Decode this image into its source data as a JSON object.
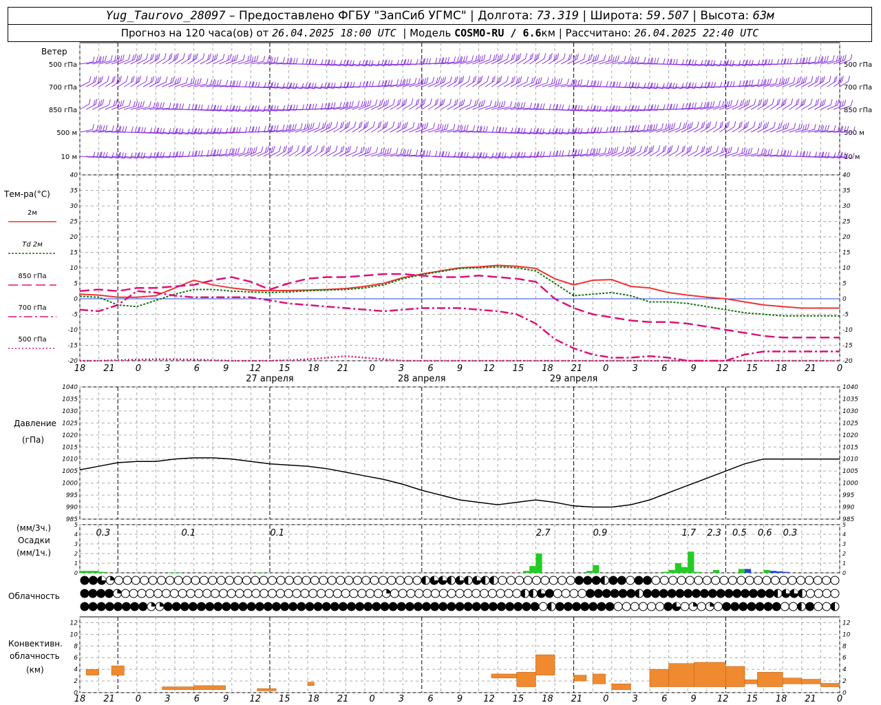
{
  "header": {
    "station": "Yug_Taurovo_28097",
    "provided_by": "– Предоставлено ФГБУ \"ЗапСиб УГМС\"",
    "lon_label": "Долгота:",
    "lon_value": "73.319",
    "lat_label": "Широта:",
    "lat_value": "59.507",
    "alt_label": "Высота:",
    "alt_value": "63м",
    "forecast_label": "Прогноз на 120 часа(ов) от",
    "forecast_start": "26.04.2025 18:00 UTC",
    "model_label": "Модель",
    "model_name": "COSMO-RU / 6.6",
    "model_unit": "км",
    "calc_label": "Рассчитано:",
    "calc_time": "26.04.2025 22:40 UTC"
  },
  "labels": {
    "wind": "Ветер",
    "wind_levels": [
      "500 гПа",
      "700 гПа",
      "850 гПа",
      "500 м",
      "10  м"
    ],
    "temp_title": "Тем-ра(°C)",
    "legend": [
      {
        "label": "2м",
        "color": "#ee3333",
        "style": "solid"
      },
      {
        "label": "Td  2м",
        "color": "#117711",
        "style": "dotted"
      },
      {
        "label": "850 гПа",
        "color": "#dd1177",
        "style": "dash"
      },
      {
        "label": "700 гПа",
        "color": "#dd1177",
        "style": "dashdot"
      },
      {
        "label": "500 гПа",
        "color": "#dd1177",
        "style": "dot"
      }
    ],
    "pressure_title": "Давление",
    "pressure_unit": "(гПа)",
    "precip_unit_3h": "(мм/3ч.)",
    "precip_title": "Осадки",
    "precip_unit_1h": "(мм/1ч.)",
    "cloud_title": "Облачность",
    "conv_title": "Конвективн.",
    "conv_title2": "облачность",
    "conv_unit": "(км)",
    "dates": [
      "27 апреля",
      "28 апреля",
      "29 апреля"
    ]
  },
  "chart_data": [
    {
      "type": "line",
      "name": "temperature",
      "ylim": [
        -20,
        40
      ],
      "yticks": [
        -20,
        -15,
        -10,
        -5,
        0,
        5,
        10,
        15,
        20,
        25,
        30,
        35,
        40
      ],
      "x_hours": [
        0,
        3,
        6,
        9,
        12,
        15,
        18,
        21,
        24,
        27,
        30,
        33,
        36,
        39,
        42,
        45,
        48,
        51,
        54,
        57,
        60,
        63,
        66,
        69,
        72,
        75,
        78,
        81,
        84,
        87,
        90,
        93,
        96,
        99,
        102,
        105,
        108,
        111,
        114,
        117,
        120
      ],
      "series": [
        {
          "name": "2м",
          "values": [
            1.5,
            1.2,
            0.5,
            0.5,
            1.0,
            3.5,
            6.0,
            4.5,
            3.5,
            2.8,
            2.6,
            2.7,
            2.8,
            3.0,
            3.3,
            4.0,
            5.0,
            6.8,
            8.0,
            9.0,
            10.0,
            10.3,
            10.8,
            10.5,
            9.8,
            6.5,
            4.5,
            6.0,
            6.2,
            4.0,
            3.5,
            2.0,
            1.2,
            0.5,
            0.0,
            -1.0,
            -2.0,
            -2.5,
            -3.0,
            -3.0,
            -3.0
          ]
        },
        {
          "name": "Td 2м",
          "values": [
            0.8,
            0.5,
            -2.0,
            -2.5,
            -0.5,
            1.5,
            3.0,
            3.0,
            2.5,
            2.2,
            2.0,
            2.2,
            2.6,
            2.8,
            3.0,
            3.5,
            4.5,
            6.5,
            7.8,
            8.8,
            9.8,
            10.0,
            10.3,
            10.0,
            9.0,
            5.0,
            1.0,
            1.5,
            2.0,
            1.0,
            -1.0,
            -1.0,
            -1.5,
            -2.5,
            -3.5,
            -4.5,
            -5.0,
            -5.5,
            -5.5,
            -5.5,
            -5.5
          ]
        },
        {
          "name": "850 гПа",
          "values": [
            2.5,
            3.0,
            2.5,
            3.5,
            3.5,
            4.0,
            4.5,
            6.0,
            7.0,
            5.5,
            3.0,
            5.0,
            6.5,
            7.0,
            7.0,
            7.5,
            8.0,
            8.0,
            7.5,
            7.0,
            7.0,
            7.5,
            7.0,
            6.5,
            5.5,
            0.0,
            -3.0,
            -5.0,
            -6.0,
            -7.0,
            -7.5,
            -7.5,
            -8.0,
            -9.0,
            -10.0,
            -11.0,
            -12.0,
            -12.5,
            -12.5,
            -12.5,
            -12.5
          ]
        },
        {
          "name": "700 гПа",
          "values": [
            -3.5,
            -4.0,
            -2.0,
            2.5,
            2.0,
            1.0,
            0.5,
            0.5,
            0.5,
            0.5,
            -0.5,
            -1.5,
            -2.0,
            -2.5,
            -3.0,
            -3.5,
            -4.0,
            -3.5,
            -3.0,
            -3.0,
            -3.0,
            -3.5,
            -4.0,
            -5.0,
            -8.0,
            -13.0,
            -16.0,
            -18.0,
            -19.0,
            -19.0,
            -18.5,
            -19.0,
            -20.0,
            -20.0,
            -20.0,
            -18.0,
            -17.0,
            -17.0,
            -17.0,
            -17.0,
            -17.0
          ]
        },
        {
          "name": "500 гПа",
          "values": [
            -20,
            -20,
            -19.8,
            -19.6,
            -19.5,
            -19.5,
            -19.6,
            -19.8,
            -20,
            -20,
            -20,
            -19.8,
            -19.5,
            -19.0,
            -18.5,
            -19.0,
            -19.5,
            -20,
            -20,
            -20,
            -20,
            -20,
            -20,
            -20,
            -20,
            -20,
            -20,
            -20,
            -20,
            -20,
            -20,
            -20,
            -20,
            -20,
            -20,
            -20,
            -20,
            -20,
            -20,
            -20,
            -20
          ]
        }
      ]
    },
    {
      "type": "line",
      "name": "pressure",
      "ylim": [
        985,
        1040
      ],
      "yticks": [
        985,
        990,
        995,
        1000,
        1005,
        1010,
        1015,
        1020,
        1025,
        1030,
        1035,
        1040
      ],
      "x_hours": [
        0,
        3,
        6,
        9,
        12,
        15,
        18,
        21,
        24,
        27,
        30,
        33,
        36,
        39,
        42,
        45,
        48,
        51,
        54,
        57,
        60,
        63,
        66,
        69,
        72,
        75,
        78,
        81,
        84,
        87,
        90,
        93,
        96,
        99,
        102,
        105,
        108,
        111,
        114,
        117,
        120
      ],
      "values": [
        1005.5,
        1007,
        1008.5,
        1009,
        1009,
        1010,
        1010.5,
        1010.5,
        1010,
        1009,
        1008,
        1007.5,
        1007,
        1006,
        1004.5,
        1003,
        1001.5,
        999.5,
        997,
        995,
        993,
        992,
        991,
        992,
        993,
        992,
        990.5,
        990,
        990,
        991,
        993,
        996,
        999,
        1002,
        1005,
        1008,
        1010,
        1010,
        1010,
        1010,
        1010
      ]
    },
    {
      "type": "bar",
      "name": "precipitation",
      "ylim": [
        0,
        5
      ],
      "period_totals": [
        {
          "hour": 1.5,
          "label": "0.3"
        },
        {
          "hour": 15,
          "label": "0.1"
        },
        {
          "hour": 29,
          "label": "0.1"
        },
        {
          "hour": 71,
          "label": "2.7"
        },
        {
          "hour": 80,
          "label": "0.9"
        },
        {
          "hour": 94,
          "label": "1.7"
        },
        {
          "hour": 98,
          "label": "2.3"
        },
        {
          "hour": 102,
          "label": "0.5"
        },
        {
          "hour": 106,
          "label": "0.6"
        },
        {
          "hour": 110,
          "label": "0.3"
        }
      ],
      "bars": [
        {
          "hour": 0,
          "value": 0.2,
          "color": "#22cc22"
        },
        {
          "hour": 1,
          "value": 0.2,
          "color": "#22cc22"
        },
        {
          "hour": 2,
          "value": 0.2,
          "color": "#22cc22"
        },
        {
          "hour": 3,
          "value": 0.1,
          "color": "#22cc22"
        },
        {
          "hour": 14,
          "value": 0.05,
          "color": "#22cc22"
        },
        {
          "hour": 15,
          "value": 0.05,
          "color": "#22cc22"
        },
        {
          "hour": 28,
          "value": 0.05,
          "color": "#22cc22"
        },
        {
          "hour": 70,
          "value": 0.2,
          "color": "#22cc22"
        },
        {
          "hour": 71,
          "value": 0.7,
          "color": "#22cc22"
        },
        {
          "hour": 72,
          "value": 2.0,
          "color": "#22cc22"
        },
        {
          "hour": 80,
          "value": 0.2,
          "color": "#22cc22"
        },
        {
          "hour": 81,
          "value": 0.8,
          "color": "#22cc22"
        },
        {
          "hour": 92,
          "value": 0.1,
          "color": "#22cc22"
        },
        {
          "hour": 93,
          "value": 0.3,
          "color": "#22cc22"
        },
        {
          "hour": 94,
          "value": 1.0,
          "color": "#22cc22"
        },
        {
          "hour": 95,
          "value": 0.6,
          "color": "#22cc22"
        },
        {
          "hour": 96,
          "value": 2.2,
          "color": "#22cc22"
        },
        {
          "hour": 97,
          "value": 0.1,
          "color": "#22cc22"
        },
        {
          "hour": 100,
          "value": 0.3,
          "color": "#22cc22"
        },
        {
          "hour": 104,
          "value": 0.4,
          "color": "#22cc22"
        },
        {
          "hour": 105,
          "value": 0.4,
          "color": "#2244dd"
        },
        {
          "hour": 108,
          "value": 0.3,
          "color": "#22cc22"
        },
        {
          "hour": 109,
          "value": 0.2,
          "color": "#2244dd"
        },
        {
          "hour": 110,
          "value": 0.15,
          "color": "#2244dd"
        },
        {
          "hour": 111,
          "value": 0.1,
          "color": "#2244dd"
        }
      ]
    },
    {
      "type": "bar",
      "name": "convective_cloud",
      "ylim": [
        0,
        13
      ],
      "yticks": [
        0,
        2,
        4,
        6,
        8,
        10,
        12
      ],
      "color": "#f08a30",
      "segments": [
        {
          "h1": 1,
          "h2": 3,
          "base": 3,
          "top": 4
        },
        {
          "h1": 5,
          "h2": 7,
          "base": 3,
          "top": 4.6
        },
        {
          "h1": 13,
          "h2": 18,
          "base": 0.5,
          "top": 1
        },
        {
          "h1": 18,
          "h2": 23,
          "base": 0.5,
          "top": 1.2
        },
        {
          "h1": 28,
          "h2": 31,
          "base": 0.3,
          "top": 0.7
        },
        {
          "h1": 36,
          "h2": 37,
          "base": 1.2,
          "top": 1.8
        },
        {
          "h1": 65,
          "h2": 69,
          "base": 2.5,
          "top": 3.2
        },
        {
          "h1": 69,
          "h2": 72,
          "base": 1,
          "top": 3.5
        },
        {
          "h1": 72,
          "h2": 75,
          "base": 3,
          "top": 6.5
        },
        {
          "h1": 78,
          "h2": 80,
          "base": 2,
          "top": 3
        },
        {
          "h1": 81,
          "h2": 83,
          "base": 1.5,
          "top": 3.2
        },
        {
          "h1": 84,
          "h2": 87,
          "base": 0.5,
          "top": 1.5
        },
        {
          "h1": 90,
          "h2": 93,
          "base": 1,
          "top": 4
        },
        {
          "h1": 93,
          "h2": 97,
          "base": 1,
          "top": 5
        },
        {
          "h1": 97,
          "h2": 102,
          "base": 1,
          "top": 5.2
        },
        {
          "h1": 102,
          "h2": 105,
          "base": 1,
          "top": 4.5
        },
        {
          "h1": 105,
          "h2": 107,
          "base": 1.5,
          "top": 2.2
        },
        {
          "h1": 107,
          "h2": 111,
          "base": 1,
          "top": 3.5
        },
        {
          "h1": 111,
          "h2": 114,
          "base": 1.5,
          "top": 2.5
        },
        {
          "h1": 114,
          "h2": 117,
          "base": 1.5,
          "top": 2.3
        },
        {
          "h1": 117,
          "h2": 120,
          "base": 1,
          "top": 1.6
        }
      ]
    },
    {
      "type": "table",
      "name": "cloud_cover",
      "rows": [
        "ddtpoooooooooooooooooooooooooooooooooooohtthththhooooooooodddhddoddoooooooooooooooooooooo",
        "ddddpoooooooooooooooooooooooooooooooopoooooooooooooooohhtdooooddddddhddddddddddddddddhtthoooo",
        "ddddddddppdddddddddddddddddddddddddddddddddddddddddddddohdddddddoooooodtopopodddddddoohdooh"
      ]
    }
  ],
  "x_axis": {
    "tick_labels": [
      "18",
      "21",
      "0",
      "3",
      "6",
      "9",
      "12",
      "15",
      "18",
      "21",
      "0",
      "3",
      "6",
      "9",
      "12",
      "15",
      "18",
      "21",
      "0",
      "3",
      "6",
      "9",
      "12",
      "15",
      "18",
      "21",
      "0"
    ],
    "wind_color": "#8833dd",
    "temp_x_end": 120
  }
}
